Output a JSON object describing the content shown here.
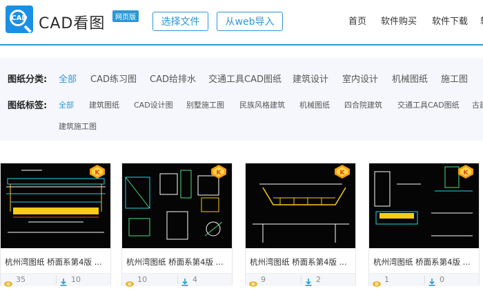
{
  "header": {
    "logo_icon_text": "CAD",
    "logo_text": "CAD看图",
    "badge": "网页版",
    "buttons": [
      "选择文件",
      "从web导入"
    ],
    "nav": [
      "首页",
      "软件购买",
      "软件下载",
      "软"
    ]
  },
  "filter": {
    "category_label": "图纸分类:",
    "categories": [
      "全部",
      "CAD练习图",
      "CAD给排水",
      "交通工具CAD图纸",
      "建筑设计",
      "室内设计",
      "机械图纸",
      "施工图"
    ],
    "tag_label": "图纸标签:",
    "tags": [
      "全部",
      "建筑图纸",
      "CAD设计图",
      "别墅施工图",
      "民族风格建筑",
      "机械图纸",
      "四合院建筑",
      "交通工具CAD图纸",
      "古建"
    ],
    "tags_row2": [
      "建筑施工图"
    ]
  },
  "cards": [
    {
      "title": "杭州湾图纸 桥面系第4版 ...",
      "views": "35",
      "downloads": "10"
    },
    {
      "title": "杭州湾图纸 桥面系第4版 ...",
      "views": "10",
      "downloads": "4"
    },
    {
      "title": "杭州湾图纸 桥面系第4版 ...",
      "views": "9",
      "downloads": "2"
    },
    {
      "title": "杭州湾图纸 桥面系第4版 ...",
      "views": "1",
      "downloads": "0"
    }
  ],
  "colors": {
    "accent": "#2c97d6",
    "eye_icon": "#e8b93a",
    "download_icon": "#2c97d6"
  },
  "icons": {
    "views": "eye-icon",
    "downloads": "download-icon",
    "badge": "cad-badge-icon"
  }
}
